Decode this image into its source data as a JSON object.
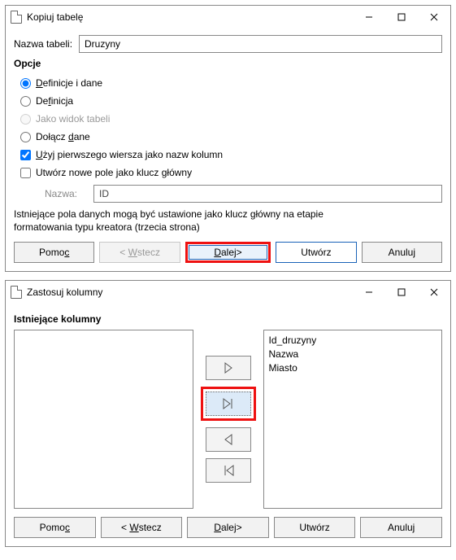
{
  "window1": {
    "title": "Kopiuj tabelę",
    "table_name_label": "Nazwa tabeli:",
    "table_name_value": "Druzyny",
    "options_heading": "Opcje",
    "radios": {
      "def_and_data": "Definicje i dane",
      "def_only": "Definicja",
      "as_view": "Jako widok tabeli",
      "append": "Dołącz dane"
    },
    "check_first_row": "Użyj pierwszego wiersza jako nazw kolumn",
    "check_new_key": "Utwórz nowe pole jako klucz główny",
    "key_name_label": "Nazwa:",
    "key_name_value": "ID",
    "hint_line1": "Istniejące pola danych mogą być ustawione jako klucz główny na etapie",
    "hint_line2": "formatowania typu kreatora (trzecia strona)",
    "buttons": {
      "help": "Pomoc",
      "back": "< Wstecz",
      "next": "Dalej>",
      "create": "Utwórz",
      "cancel": "Anuluj"
    }
  },
  "window2": {
    "title": "Zastosuj kolumny",
    "left_heading": "Istniejące kolumny",
    "right_items": [
      "Id_druzyny",
      "Nazwa",
      "Miasto"
    ],
    "buttons": {
      "help": "Pomoc",
      "back": "< Wstecz",
      "next": "Dalej>",
      "create": "Utwórz",
      "cancel": "Anuluj"
    }
  }
}
